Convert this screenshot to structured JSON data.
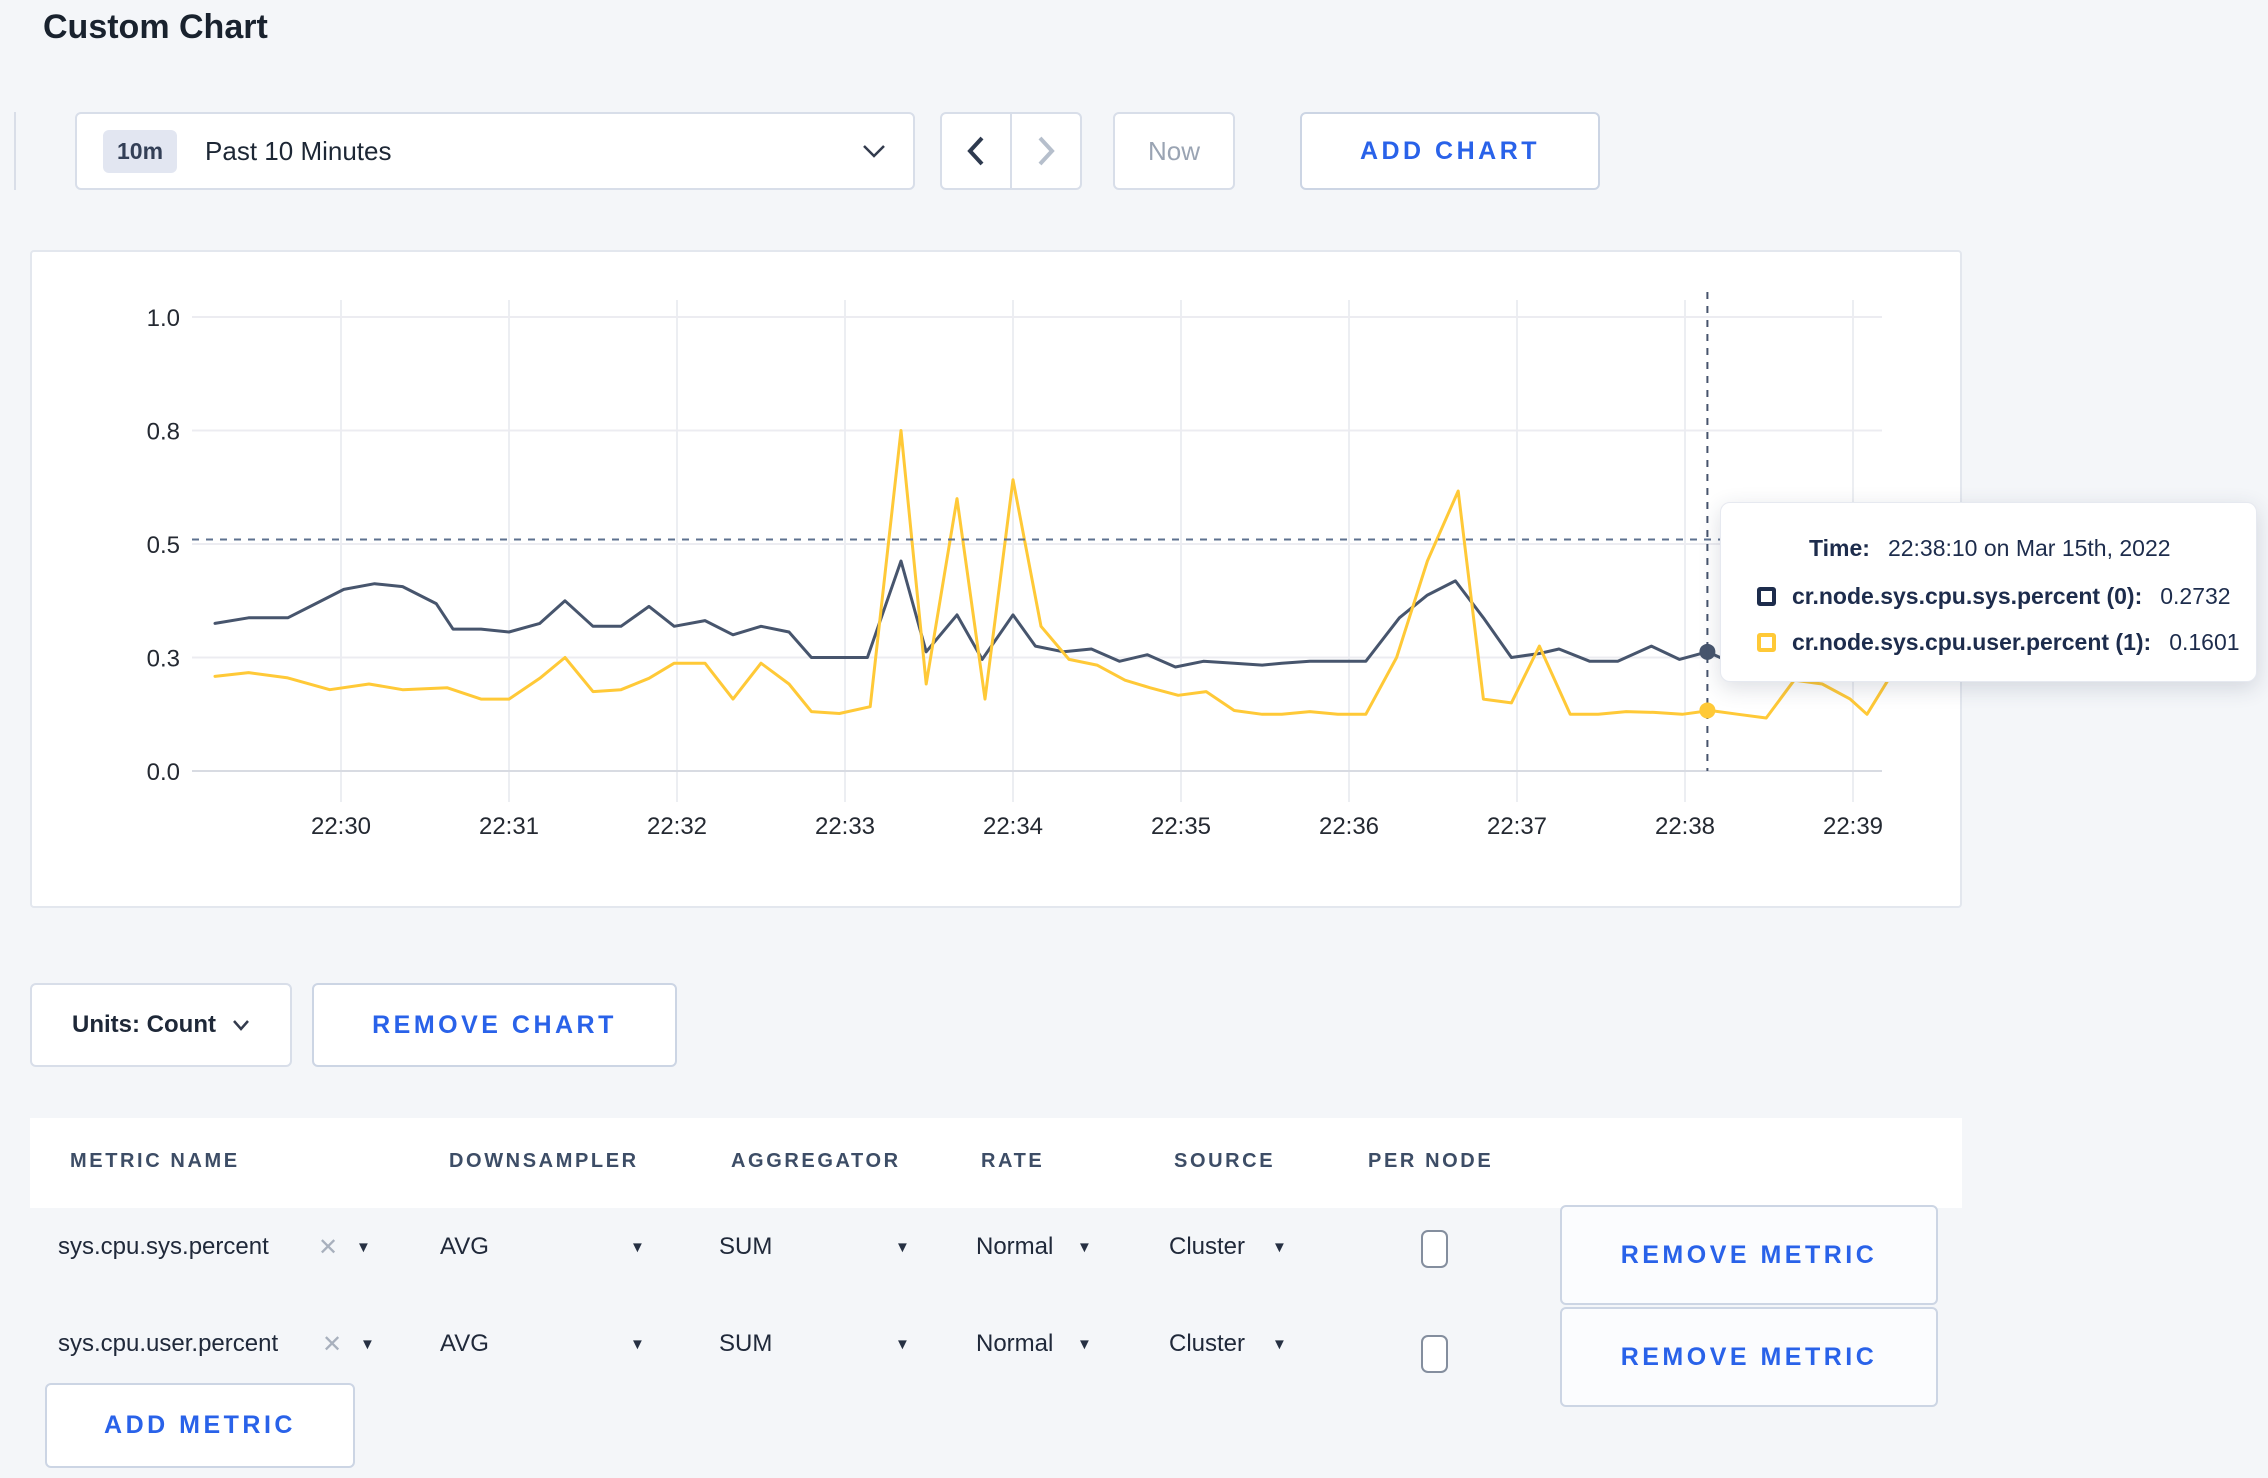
{
  "page": {
    "title": "Custom Chart"
  },
  "icons": {
    "clear": "✕",
    "caret_down": "▼"
  },
  "toolbar": {
    "range_badge": "10m",
    "range_label": "Past 10 Minutes",
    "now_label": "Now",
    "add_chart_label": "ADD CHART"
  },
  "chart_controls": {
    "units_label": "Units: Count",
    "remove_chart_label": "REMOVE CHART"
  },
  "tooltip": {
    "time_label": "Time:",
    "time_value": "22:38:10 on Mar 15th, 2022",
    "series": [
      {
        "name": "cr.node.sys.cpu.sys.percent (0):",
        "value": "0.2732",
        "color": "#1d2c4c"
      },
      {
        "name": "cr.node.sys.cpu.user.percent (1):",
        "value": "0.1601",
        "color": "#ffc937"
      }
    ]
  },
  "chart_data": {
    "type": "line",
    "title": "",
    "xlabel": "",
    "ylabel": "",
    "grid": true,
    "legend_position": "tooltip",
    "time_base": "22:29:00",
    "y_scale_stops": [
      0,
      0.3,
      0.5,
      0.8,
      1.0
    ],
    "y_ticks": [
      {
        "v": 0,
        "label": "0.0"
      },
      {
        "v": 0.3,
        "label": "0.3"
      },
      {
        "v": 0.5,
        "label": "0.5"
      },
      {
        "v": 0.8,
        "label": "0.8"
      },
      {
        "v": 1.0,
        "label": "1.0"
      }
    ],
    "x_ticks": [
      {
        "t": 60,
        "label": "22:30"
      },
      {
        "t": 120,
        "label": "22:31"
      },
      {
        "t": 180,
        "label": "22:32"
      },
      {
        "t": 240,
        "label": "22:33"
      },
      {
        "t": 300,
        "label": "22:34"
      },
      {
        "t": 360,
        "label": "22:35"
      },
      {
        "t": 420,
        "label": "22:36"
      },
      {
        "t": 480,
        "label": "22:37"
      },
      {
        "t": 540,
        "label": "22:38"
      },
      {
        "t": 600,
        "label": "22:39"
      }
    ],
    "series": [
      {
        "name": "cr.node.sys.cpu.sys.percent",
        "color": "#47556d",
        "points": [
          [
            15,
            0.36
          ],
          [
            27,
            0.37
          ],
          [
            41,
            0.37
          ],
          [
            51,
            0.395
          ],
          [
            61,
            0.42
          ],
          [
            72,
            0.43
          ],
          [
            82,
            0.425
          ],
          [
            94,
            0.395
          ],
          [
            100,
            0.35
          ],
          [
            110,
            0.35
          ],
          [
            120,
            0.345
          ],
          [
            131,
            0.36
          ],
          [
            140,
            0.4
          ],
          [
            150,
            0.355
          ],
          [
            160,
            0.355
          ],
          [
            170,
            0.39
          ],
          [
            179,
            0.355
          ],
          [
            190,
            0.365
          ],
          [
            200,
            0.34
          ],
          [
            210,
            0.355
          ],
          [
            220,
            0.345
          ],
          [
            228,
            0.3
          ],
          [
            238,
            0.3
          ],
          [
            248,
            0.3
          ],
          [
            260,
            0.47
          ],
          [
            269,
            0.31
          ],
          [
            280,
            0.375
          ],
          [
            289,
            0.295
          ],
          [
            300,
            0.375
          ],
          [
            308,
            0.32
          ],
          [
            318,
            0.31
          ],
          [
            328,
            0.315
          ],
          [
            338,
            0.29
          ],
          [
            348,
            0.305
          ],
          [
            358,
            0.275
          ],
          [
            368,
            0.29
          ],
          [
            379,
            0.285
          ],
          [
            389,
            0.28
          ],
          [
            396,
            0.285
          ],
          [
            406,
            0.29
          ],
          [
            416,
            0.29
          ],
          [
            426,
            0.29
          ],
          [
            438,
            0.37
          ],
          [
            448,
            0.41
          ],
          [
            458,
            0.435
          ],
          [
            468,
            0.37
          ],
          [
            478,
            0.3
          ],
          [
            488,
            0.307
          ],
          [
            495,
            0.315
          ],
          [
            506,
            0.29
          ],
          [
            516,
            0.29
          ],
          [
            528,
            0.32
          ],
          [
            538,
            0.295
          ],
          [
            548,
            0.31
          ],
          [
            554,
            0.295
          ],
          [
            564,
            0.29
          ],
          [
            575,
            0.29
          ],
          [
            585,
            0.29
          ],
          [
            595,
            0.295
          ],
          [
            605,
            0.29
          ],
          [
            615,
            0.3
          ]
        ]
      },
      {
        "name": "cr.node.sys.cpu.user.percent",
        "color": "#ffc937",
        "points": [
          [
            15,
            0.25
          ],
          [
            27,
            0.26
          ],
          [
            41,
            0.246
          ],
          [
            56,
            0.215
          ],
          [
            70,
            0.23
          ],
          [
            82,
            0.215
          ],
          [
            98,
            0.22
          ],
          [
            110,
            0.19
          ],
          [
            120,
            0.19
          ],
          [
            131,
            0.245
          ],
          [
            140,
            0.3
          ],
          [
            150,
            0.21
          ],
          [
            160,
            0.215
          ],
          [
            170,
            0.245
          ],
          [
            179,
            0.285
          ],
          [
            190,
            0.285
          ],
          [
            200,
            0.19
          ],
          [
            210,
            0.285
          ],
          [
            220,
            0.23
          ],
          [
            228,
            0.157
          ],
          [
            238,
            0.152
          ],
          [
            249,
            0.17
          ],
          [
            260,
            0.8
          ],
          [
            269,
            0.23
          ],
          [
            280,
            0.62
          ],
          [
            290,
            0.19
          ],
          [
            300,
            0.67
          ],
          [
            310,
            0.355
          ],
          [
            320,
            0.295
          ],
          [
            330,
            0.28
          ],
          [
            340,
            0.24
          ],
          [
            349,
            0.22
          ],
          [
            359,
            0.2
          ],
          [
            369,
            0.21
          ],
          [
            379,
            0.16
          ],
          [
            389,
            0.15
          ],
          [
            396,
            0.15
          ],
          [
            406,
            0.157
          ],
          [
            416,
            0.15
          ],
          [
            426,
            0.15
          ],
          [
            437,
            0.3
          ],
          [
            448,
            0.47
          ],
          [
            459,
            0.64
          ],
          [
            468,
            0.19
          ],
          [
            478,
            0.18
          ],
          [
            488,
            0.32
          ],
          [
            499,
            0.15
          ],
          [
            509,
            0.15
          ],
          [
            519,
            0.157
          ],
          [
            529,
            0.155
          ],
          [
            539,
            0.15
          ],
          [
            549,
            0.16
          ],
          [
            559,
            0.15
          ],
          [
            569,
            0.14
          ],
          [
            579,
            0.24
          ],
          [
            589,
            0.23
          ],
          [
            599,
            0.19
          ],
          [
            605,
            0.15
          ],
          [
            615,
            0.27
          ]
        ]
      }
    ],
    "crosshair": {
      "t": 548,
      "hline_value": 0.512,
      "dots": [
        {
          "series": 0,
          "v": 0.31
        },
        {
          "series": 1,
          "v": 0.16
        }
      ]
    }
  },
  "metrics_table": {
    "headers": [
      "METRIC NAME",
      "DOWNSAMPLER",
      "AGGREGATOR",
      "RATE",
      "SOURCE",
      "PER NODE"
    ],
    "rows": [
      {
        "metric": "sys.cpu.sys.percent",
        "downsampler": "AVG",
        "aggregator": "SUM",
        "rate": "Normal",
        "source": "Cluster",
        "per_node_checked": false,
        "remove_label": "REMOVE METRIC"
      },
      {
        "metric": "sys.cpu.user.percent",
        "downsampler": "AVG",
        "aggregator": "SUM",
        "rate": "Normal",
        "source": "Cluster",
        "per_node_checked": false,
        "remove_label": "REMOVE METRIC"
      }
    ],
    "add_metric_label": "ADD METRIC"
  }
}
